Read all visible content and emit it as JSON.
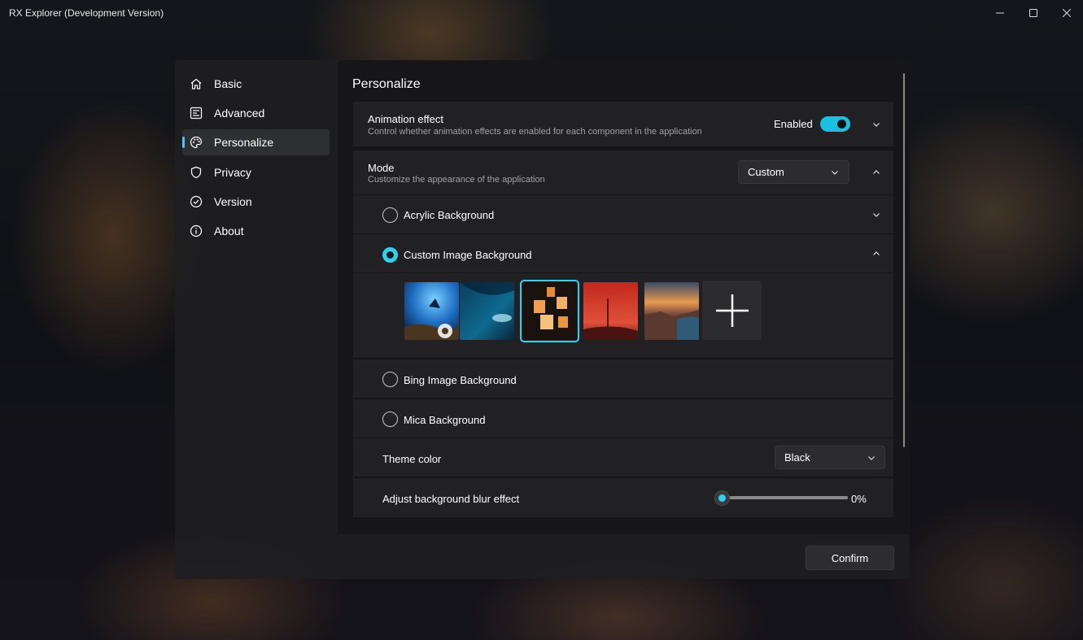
{
  "window": {
    "title": "RX Explorer (Development Version)",
    "controls": {
      "minimize_icon": "minimize-icon",
      "maximize_icon": "maximize-icon",
      "close_icon": "close-icon"
    }
  },
  "nav": {
    "items": [
      {
        "label": "Basic",
        "icon": "home-icon"
      },
      {
        "label": "Advanced",
        "icon": "advanced-settings-icon"
      },
      {
        "label": "Personalize",
        "icon": "palette-icon",
        "active": true
      },
      {
        "label": "Privacy",
        "icon": "shield-icon"
      },
      {
        "label": "Version",
        "icon": "check-circle-icon"
      },
      {
        "label": "About",
        "icon": "info-icon"
      }
    ]
  },
  "content": {
    "title": "Personalize",
    "animation": {
      "title": "Animation effect",
      "description": "Control whether animation effects are enabled for each component in the application",
      "state_label": "Enabled",
      "enabled": true
    },
    "mode": {
      "title": "Mode",
      "description": "Customize the appearance of the application",
      "selected": "Custom"
    },
    "backgrounds": {
      "acrylic": {
        "label": "Acrylic Background",
        "checked": false
      },
      "custom_image": {
        "label": "Custom Image Background",
        "checked": true
      },
      "bing": {
        "label": "Bing Image Background",
        "checked": false
      },
      "mica": {
        "label": "Mica Background",
        "checked": false
      }
    },
    "thumbnails": [
      {
        "name": "ori-game-art",
        "selected": false
      },
      {
        "name": "ice-cave",
        "selected": false
      },
      {
        "name": "floating-lanterns",
        "selected": true
      },
      {
        "name": "red-landscape",
        "selected": false
      },
      {
        "name": "coastal-town-sunset",
        "selected": false
      }
    ],
    "add_image_icon": "plus-icon",
    "theme_color": {
      "label": "Theme color",
      "selected": "Black"
    },
    "blur": {
      "label": "Adjust background blur effect",
      "value_text": "0%",
      "value": 0
    }
  },
  "footer": {
    "confirm_label": "Confirm"
  },
  "colors": {
    "accent": "#2cd2ef",
    "toggle_on": "#17c2e0",
    "nav_indicator": "#4cc2ff",
    "card": "#212124",
    "panel": "#161618"
  }
}
